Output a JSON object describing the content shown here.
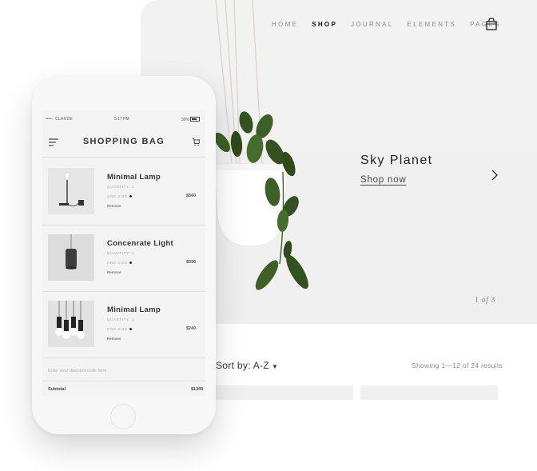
{
  "desktop": {
    "nav": [
      "HOME",
      "SHOP",
      "JOURNAL",
      "ELEMENTS",
      "PAGES"
    ],
    "active_nav": "SHOP",
    "hero": {
      "title": "Sky Planet",
      "link": "Shop now",
      "pager_current": "1",
      "pager_of": "of",
      "pager_total": "3"
    },
    "shop": {
      "sort": "Sort by: A-Z",
      "results": "Showing 1—12 of 24 results"
    }
  },
  "phone": {
    "status": {
      "carrier": "••••◦ CLAUDE",
      "time": "5:17 PM",
      "battery": "30%"
    },
    "title": "SHOPPING BAG",
    "items": [
      {
        "name": "Minimal Lamp",
        "quantity": "QUANTITY: 2",
        "size": "ONE SIZE",
        "price": "$560",
        "remove": "Remove"
      },
      {
        "name": "Concenrate Light",
        "quantity": "QUANTITY: 1",
        "size": "ONE SIZE",
        "price": "$590",
        "remove": "Remove"
      },
      {
        "name": "Minimal Lamp",
        "quantity": "QUANTITY: 1",
        "size": "ONE SIZE",
        "price": "$240",
        "remove": "Remove"
      }
    ],
    "discount_placeholder": "Enter your discount code here",
    "subtotal_label": "Subtotal",
    "subtotal_value": "$1340"
  },
  "icons": {
    "bag": "shopping-bag-icon",
    "next": "chevron-right-icon",
    "menu": "menu-icon",
    "cart": "cart-icon"
  },
  "colors": {
    "background": "#f1f1f1",
    "text": "#222222",
    "muted": "#8a8a8a"
  }
}
